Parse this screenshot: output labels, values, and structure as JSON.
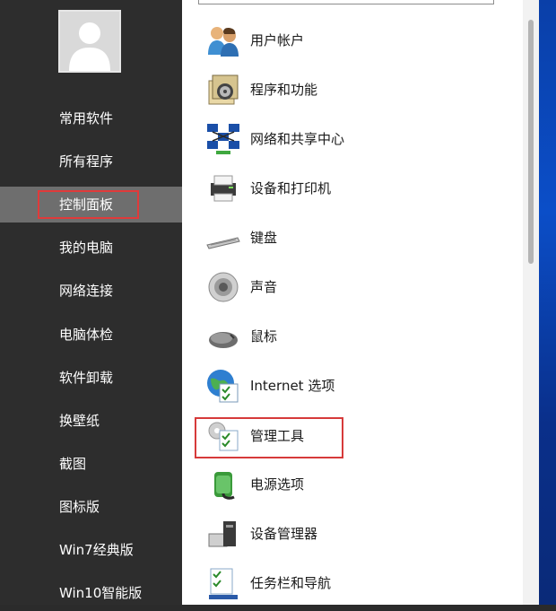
{
  "sidebar": {
    "items": [
      {
        "label": "常用软件"
      },
      {
        "label": "所有程序"
      },
      {
        "label": "控制面板",
        "selected": true
      },
      {
        "label": "我的电脑"
      },
      {
        "label": "网络连接"
      },
      {
        "label": "电脑体检"
      },
      {
        "label": "软件卸载"
      },
      {
        "label": "换壁纸"
      },
      {
        "label": "截图"
      },
      {
        "label": "图标版"
      },
      {
        "label": "Win7经典版"
      },
      {
        "label": "Win10智能版"
      }
    ]
  },
  "control_panel": {
    "items": [
      {
        "label": "用户帐户",
        "icon": "users-icon"
      },
      {
        "label": "程序和功能",
        "icon": "programs-icon"
      },
      {
        "label": "网络和共享中心",
        "icon": "network-icon"
      },
      {
        "label": "设备和打印机",
        "icon": "printer-icon"
      },
      {
        "label": "键盘",
        "icon": "keyboard-icon"
      },
      {
        "label": "声音",
        "icon": "speaker-icon"
      },
      {
        "label": "鼠标",
        "icon": "mouse-icon"
      },
      {
        "label": "Internet 选项",
        "icon": "internet-options-icon"
      },
      {
        "label": "管理工具",
        "icon": "admin-tools-icon",
        "highlighted": true
      },
      {
        "label": "电源选项",
        "icon": "power-icon"
      },
      {
        "label": "设备管理器",
        "icon": "device-manager-icon"
      },
      {
        "label": "任务栏和导航",
        "icon": "taskbar-icon"
      }
    ]
  },
  "colors": {
    "sidebar_bg": "#2d2d2d",
    "selected_bg": "#6e6e6e",
    "highlight_border": "#e03a3a",
    "panel_bg": "#ffffff"
  }
}
